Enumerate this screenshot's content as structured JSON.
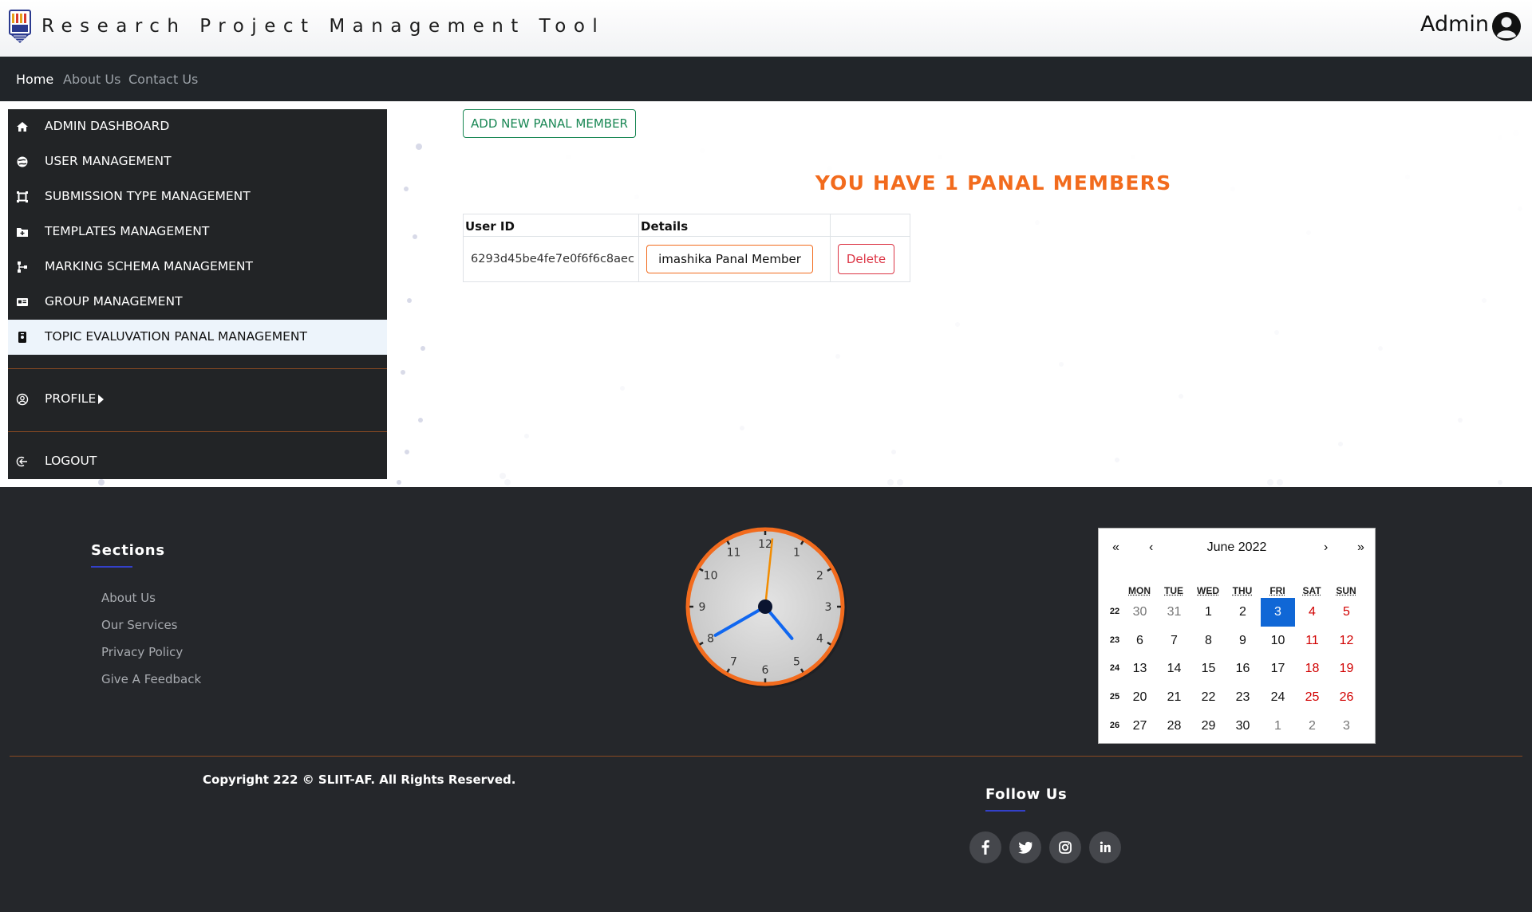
{
  "header": {
    "title": "Research Project Management Tool",
    "user_name": "Admin"
  },
  "nav": {
    "items": [
      {
        "label": "Home",
        "active": true
      },
      {
        "label": "About Us",
        "active": false
      },
      {
        "label": "Contact Us",
        "active": false
      }
    ]
  },
  "sidebar": {
    "items": [
      {
        "label": "ADMIN DASHBOARD",
        "icon": "home-icon"
      },
      {
        "label": "USER MANAGEMENT",
        "icon": "globe-icon"
      },
      {
        "label": "SUBMISSION TYPE MANAGEMENT",
        "icon": "crop-icon"
      },
      {
        "label": "TEMPLATES MANAGEMENT",
        "icon": "folder-plus-icon"
      },
      {
        "label": "MARKING SCHEMA MANAGEMENT",
        "icon": "diagram-icon"
      },
      {
        "label": "GROUP MANAGEMENT",
        "icon": "card-icon"
      },
      {
        "label": "TOPIC EVALUVATION PANAL MANAGEMENT",
        "icon": "badge-icon",
        "active": true
      }
    ],
    "profile_label": "PROFILE",
    "logout_label": "LOGOUT"
  },
  "main": {
    "add_button_label": "ADD NEW PANAL MEMBER",
    "count_title": "YOU HAVE 1 PANAL MEMBERS",
    "table": {
      "headers": [
        "User ID",
        "Details",
        ""
      ],
      "rows": [
        {
          "user_id": "6293d45be4fe7e0f6f6c8aec",
          "details_label": "imashika Panal Member",
          "delete_label": "Delete"
        }
      ]
    }
  },
  "footer": {
    "sections_title": "Sections",
    "links": [
      "About Us",
      "Our Services",
      "Privacy Policy",
      "Give A Feedback"
    ],
    "clock": {
      "hour": 4,
      "minute": 40,
      "second": 1
    },
    "calendar": {
      "month_label": "June 2022",
      "nav": [
        "«",
        "‹",
        "›",
        "»"
      ],
      "weekdays": [
        "MON",
        "TUE",
        "WED",
        "THU",
        "FRI",
        "SAT",
        "SUN"
      ],
      "weeks": [
        {
          "num": "22",
          "days": [
            "30",
            "31",
            "1",
            "2",
            "3",
            "4",
            "5"
          ]
        },
        {
          "num": "23",
          "days": [
            "6",
            "7",
            "8",
            "9",
            "10",
            "11",
            "12"
          ]
        },
        {
          "num": "24",
          "days": [
            "13",
            "14",
            "15",
            "16",
            "17",
            "18",
            "19"
          ]
        },
        {
          "num": "25",
          "days": [
            "20",
            "21",
            "22",
            "23",
            "24",
            "25",
            "26"
          ]
        },
        {
          "num": "26",
          "days": [
            "27",
            "28",
            "29",
            "30",
            "1",
            "2",
            "3"
          ]
        }
      ],
      "selected_day": "3"
    },
    "copyright": "Copyright 222 © SLIIT-AF. All Rights Reserved.",
    "follow_title": "Follow Us",
    "social": [
      "facebook-icon",
      "twitter-icon",
      "instagram-icon",
      "linkedin-icon"
    ],
    "colors": {
      "accent_orange": "#f26b1d",
      "calendar_today": "#1067d6",
      "weekend_red": "#d10000"
    }
  }
}
